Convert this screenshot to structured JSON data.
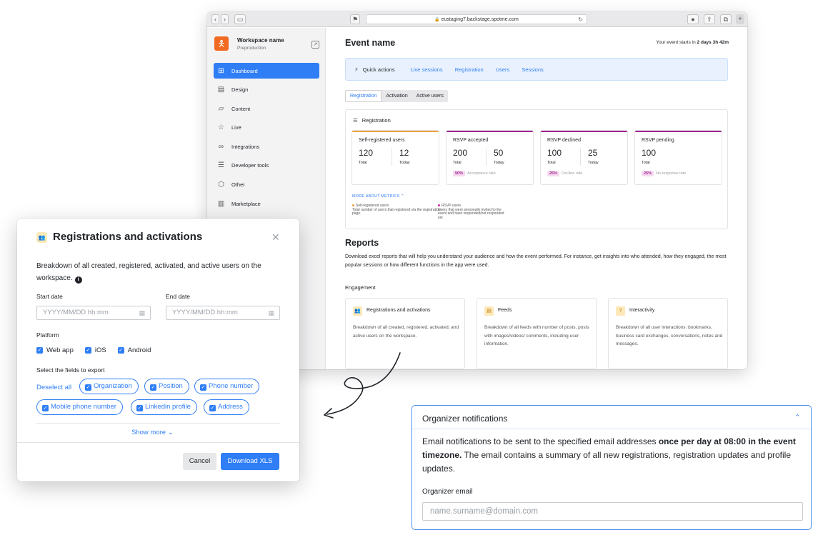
{
  "browser": {
    "url": "eustaging7.backstage.spotme.com",
    "workspace": {
      "name": "Workspace name",
      "subtitle": "Preproduction"
    },
    "nav": [
      {
        "label": "Dashboard",
        "icon": "dashboard-icon",
        "active": true
      },
      {
        "label": "Design",
        "icon": "design-icon"
      },
      {
        "label": "Content",
        "icon": "folder-icon"
      },
      {
        "label": "Live",
        "icon": "star-icon"
      },
      {
        "label": "Integrations",
        "icon": "link-icon"
      },
      {
        "label": "Developer tools",
        "icon": "database-icon"
      },
      {
        "label": "Other",
        "icon": "box-icon"
      },
      {
        "label": "Marketplace",
        "icon": "store-icon"
      }
    ],
    "event": {
      "title": "Event name",
      "starts_prefix": "Your event starts in",
      "starts_value": "2 days 3h 42m"
    },
    "quick_actions": {
      "label": "Quick actions",
      "links": [
        "Live sessions",
        "Registration",
        "Users",
        "Sessions"
      ]
    },
    "tabs": [
      "Registration",
      "Activation",
      "Active users"
    ],
    "registration": {
      "heading": "Registration",
      "metrics": [
        {
          "title": "Self-registered users",
          "v1": "120",
          "l1": "Total",
          "v2": "12",
          "l2": "Today",
          "rate_badge": "",
          "rate_label": "",
          "color": "#f0a33a"
        },
        {
          "title": "RSVP accepted",
          "v1": "200",
          "l1": "Total",
          "v2": "50",
          "l2": "Today",
          "rate_badge": "50%",
          "rate_label": "Acceptance rate",
          "color": "#a02590"
        },
        {
          "title": "RSVP declined",
          "v1": "100",
          "l1": "Total",
          "v2": "25",
          "l2": "Today",
          "rate_badge": "25%",
          "rate_label": "Decline rate",
          "color": "#a02590"
        },
        {
          "title": "RSVP pending",
          "v1": "100",
          "l1": "Total",
          "v2": "",
          "l2": "",
          "rate_badge": "25%",
          "rate_label": "No response rate",
          "color": "#a02590"
        }
      ],
      "more_label": "MORE ABOUT METRICS",
      "legend": [
        {
          "title": "Self-registered users",
          "text": "Total number of users that registered via the registration page.",
          "color": "#f0a33a"
        },
        {
          "title": "RSVP users",
          "text": "Users that were personally invited to the event and have responded/not responded yet",
          "color": "#d0309b"
        }
      ]
    },
    "reports": {
      "heading": "Reports",
      "description": "Download excel reports that will help you understand your audience and how the event performed. For instance, get insights into who attended, how they engaged, the most popular sessions or how different functions in the app were used.",
      "section": "Engagement",
      "cards": [
        {
          "title": "Registrations and activations",
          "desc": "Breakdown of all created, registered, activated, and active users on the workspace.",
          "icon": "users-icon"
        },
        {
          "title": "Feeds",
          "desc": "Breakdown of all feeds with number of posts, posts with images/videos/ comments, including user information.",
          "icon": "feed-icon"
        },
        {
          "title": "Interactivity",
          "desc": "Breakdown of all user interactions: bookmarks, business card exchanges, conversations, notes and messages.",
          "icon": "chat-icon"
        }
      ]
    }
  },
  "modal": {
    "title": "Registrations and activations",
    "description": "Breakdown of all created, registered, activated, and active users on the workspace.",
    "start_label": "Start date",
    "end_label": "End date",
    "date_placeholder": "YYYY/MM/DD hh:mm",
    "platform_label": "Platform",
    "platforms": [
      "Web app",
      "iOS",
      "Android"
    ],
    "fields_label": "Select the fields to export",
    "deselect_label": "Deselect all",
    "fields": [
      "Organization",
      "Position",
      "Phone number",
      "Mobile phone number",
      "Linkedin profile",
      "Address"
    ],
    "show_more": "Show more",
    "cancel": "Cancel",
    "download": "Download XLS"
  },
  "organizer": {
    "title": "Organizer notifications",
    "desc_before": "Email notifications to be sent to the specified email addresses ",
    "desc_bold": "once per day at 08:00 in the event timezone.",
    "desc_after": " The email contains a summary of all new registrations, registration updates and profile updates.",
    "email_label": "Organizer email",
    "email_placeholder": "name.surname@domain.com"
  }
}
